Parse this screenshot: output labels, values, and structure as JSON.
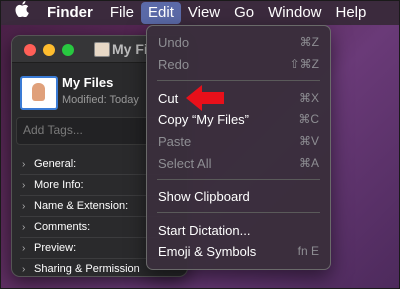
{
  "menubar": {
    "apple_icon": "apple-logo-icon",
    "items": [
      "Finder",
      "File",
      "Edit",
      "View",
      "Go",
      "Window",
      "Help"
    ]
  },
  "info_window": {
    "title": "My Fi",
    "file_name": "My Files",
    "modified": "Modified: Today",
    "tags_placeholder": "Add Tags...",
    "sections": [
      "General:",
      "More Info:",
      "Name & Extension:",
      "Comments:",
      "Preview:",
      "Sharing & Permission"
    ]
  },
  "edit_menu": {
    "undo": {
      "label": "Undo",
      "shortcut": "⌘Z"
    },
    "redo": {
      "label": "Redo",
      "shortcut": "⇧⌘Z"
    },
    "cut": {
      "label": "Cut",
      "shortcut": "⌘X"
    },
    "copy": {
      "label": "Copy “My Files”",
      "shortcut": "⌘C"
    },
    "paste": {
      "label": "Paste",
      "shortcut": "⌘V"
    },
    "select_all": {
      "label": "Select All",
      "shortcut": "⌘A"
    },
    "show_clipboard": {
      "label": "Show Clipboard"
    },
    "start_dictation": {
      "label": "Start Dictation..."
    },
    "emoji_symbols": {
      "label": "Emoji & Symbols",
      "shortcut": "fn E"
    }
  },
  "colors": {
    "menubar_bg": "#3b2a3d",
    "menu_highlight": "#5b6aa8",
    "annotation_arrow": "#e8101a"
  }
}
